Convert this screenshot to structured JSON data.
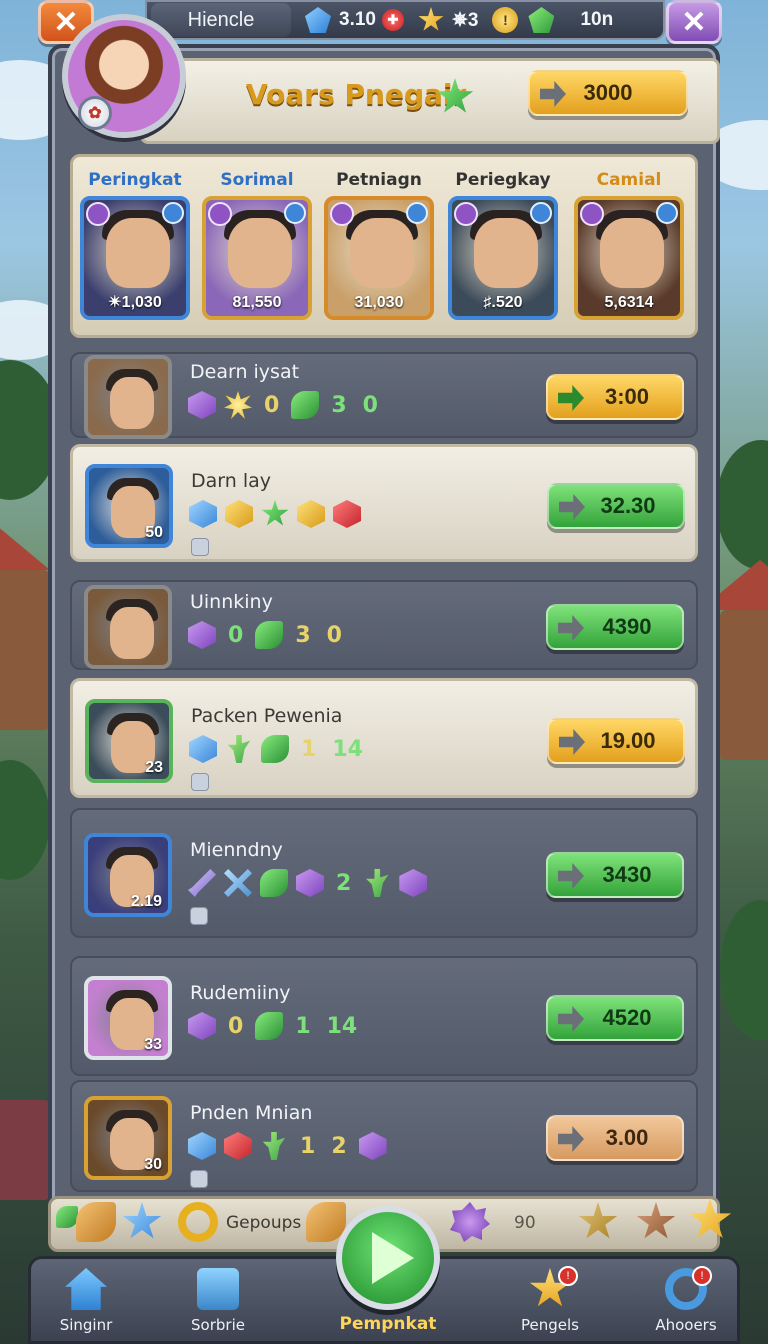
{
  "topbar": {
    "player_name": "Hiencle",
    "gem_value": "3.10",
    "star_value": "✵3",
    "green_value": "10n"
  },
  "header": {
    "title": "Voars Pnegair",
    "action_value": "3000"
  },
  "heroes": [
    {
      "label": "Peringkat",
      "value": "✴1,030",
      "label_color": "#2f6fc4",
      "border": "#3f86d8",
      "bg": "#3b3f6e"
    },
    {
      "label": "Sorimal",
      "value": "81,550",
      "label_color": "#2f6fc4",
      "border": "#d7a233",
      "bg": "#8a67b8"
    },
    {
      "label": "Petniagn",
      "value": "31,030",
      "label_color": "#333333",
      "border": "#d78a2a",
      "bg": "#caa06a"
    },
    {
      "label": "Periegkay",
      "value": "♯.520",
      "label_color": "#333333",
      "border": "#3f86d8",
      "bg": "#3c4b5a"
    },
    {
      "label": "Camial",
      "value": "5,6314",
      "label_color": "#d58b18",
      "border": "#d7a233",
      "bg": "#5a3a2a"
    }
  ],
  "rows": [
    {
      "name": "Dearn iysat",
      "level": "",
      "numbers": [
        "0",
        "3",
        "0"
      ],
      "button_label": "3:00",
      "button_style": "yellow"
    },
    {
      "name": "Darn lay",
      "level": "50",
      "numbers": [],
      "button_label": "32.30",
      "button_style": "green"
    },
    {
      "name": "Uinnkiny",
      "level": "",
      "numbers": [
        "0",
        "3",
        "0"
      ],
      "button_label": "4390",
      "button_style": "green"
    },
    {
      "name": "Packen Pewenia",
      "level": "23",
      "numbers": [
        "1",
        "14"
      ],
      "button_label": "19.00",
      "button_style": "yellow"
    },
    {
      "name": "Mienndny",
      "level": "2.19",
      "numbers": [
        "2"
      ],
      "button_label": "3430",
      "button_style": "green"
    },
    {
      "name": "Rudemiiny",
      "level": "33",
      "numbers": [
        "0",
        "1",
        "14"
      ],
      "button_label": "4520",
      "button_style": "green"
    },
    {
      "name": "Pnden Mnian",
      "level": "30",
      "numbers": [
        "1",
        "2"
      ],
      "button_label": "3.00",
      "button_style": "tan"
    }
  ],
  "bottom_strip": {
    "center_label": "Gepoups",
    "right_value": "90"
  },
  "nav": {
    "items": [
      {
        "label": "Singinr"
      },
      {
        "label": "Sorbrie"
      },
      {
        "label": "Pempnkat"
      },
      {
        "label": "Pengels"
      },
      {
        "label": "Ahooers"
      }
    ]
  },
  "colors": {
    "accent_gold": "#d79a1d",
    "button_green": "#34a33b",
    "button_yellow": "#e3a01d",
    "frame": "#5b6272"
  }
}
